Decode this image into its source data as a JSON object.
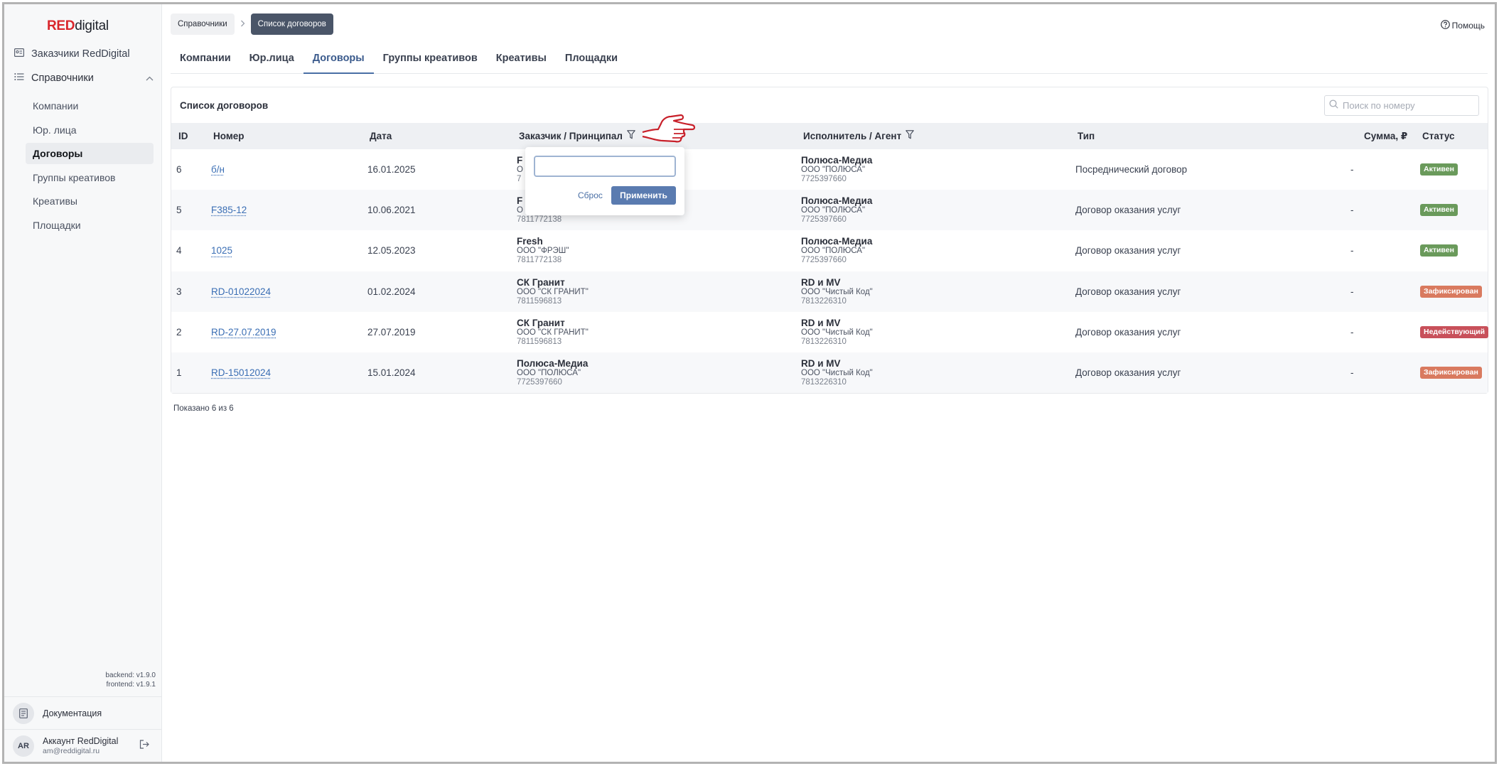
{
  "sidebar": {
    "logo_red": "RED",
    "logo_rest": "digital",
    "top_item": "Заказчики RedDigital",
    "section": "Справочники",
    "items": [
      {
        "label": "Компании",
        "active": false
      },
      {
        "label": "Юр. лица",
        "active": false
      },
      {
        "label": "Договоры",
        "active": true
      },
      {
        "label": "Группы креативов",
        "active": false
      },
      {
        "label": "Креативы",
        "active": false
      },
      {
        "label": "Площадки",
        "active": false
      }
    ],
    "backend_version": "backend: v1.9.0",
    "frontend_version": "frontend: v1.9.1",
    "docs": "Документация",
    "account_initials": "AR",
    "account_name": "Аккаунт RedDigital",
    "account_email": "am@reddigital.ru"
  },
  "breadcrumb": {
    "root": "Справочники",
    "current": "Список договоров"
  },
  "help": "Помощь",
  "tabs": [
    {
      "label": "Компании",
      "active": false
    },
    {
      "label": "Юр.лица",
      "active": false
    },
    {
      "label": "Договоры",
      "active": true
    },
    {
      "label": "Группы креативов",
      "active": false
    },
    {
      "label": "Креативы",
      "active": false
    },
    {
      "label": "Площадки",
      "active": false
    }
  ],
  "card": {
    "title": "Список договоров",
    "search_placeholder": "Поиск по номеру"
  },
  "table": {
    "headers": {
      "id": "ID",
      "number": "Номер",
      "date": "Дата",
      "client": "Заказчик / Принципал",
      "contractor": "Исполнитель / Агент",
      "type": "Тип",
      "sum": "Сумма, ₽",
      "status": "Статус"
    },
    "rows": [
      {
        "id": "6",
        "number": "б/н",
        "date": "16.01.2025",
        "client": {
          "name": "F",
          "legal": "О",
          "inn": "7"
        },
        "contractor": {
          "name": "Полюса-Медиа",
          "legal": "ООО \"ПОЛЮСА\"",
          "inn": "7725397660"
        },
        "type": "Посреднический договор",
        "sum": "-",
        "status": "Активен",
        "status_color": "#6a9a5b"
      },
      {
        "id": "5",
        "number": "F385-12",
        "date": "10.06.2021",
        "client": {
          "name": "F",
          "legal": "О",
          "inn": "7811772138"
        },
        "contractor": {
          "name": "Полюса-Медиа",
          "legal": "ООО \"ПОЛЮСА\"",
          "inn": "7725397660"
        },
        "type": "Договор оказания услуг",
        "sum": "-",
        "status": "Активен",
        "status_color": "#6a9a5b"
      },
      {
        "id": "4",
        "number": "1025",
        "date": "12.05.2023",
        "client": {
          "name": "Fresh",
          "legal": "ООО \"ФРЭШ\"",
          "inn": "7811772138"
        },
        "contractor": {
          "name": "Полюса-Медиа",
          "legal": "ООО \"ПОЛЮСА\"",
          "inn": "7725397660"
        },
        "type": "Договор оказания услуг",
        "sum": "-",
        "status": "Активен",
        "status_color": "#6a9a5b"
      },
      {
        "id": "3",
        "number": "RD-01022024",
        "date": "01.02.2024",
        "client": {
          "name": "СК Гранит",
          "legal": "ООО \"СК ГРАНИТ\"",
          "inn": "7811596813"
        },
        "contractor": {
          "name": "RD и MV",
          "legal": "ООО \"Чистый Код\"",
          "inn": "7813226310"
        },
        "type": "Договор оказания услуг",
        "sum": "-",
        "status": "Зафиксирован",
        "status_color": "#d97a5f"
      },
      {
        "id": "2",
        "number": "RD-27.07.2019",
        "date": "27.07.2019",
        "client": {
          "name": "СК Гранит",
          "legal": "ООО \"СК ГРАНИТ\"",
          "inn": "7811596813"
        },
        "contractor": {
          "name": "RD и MV",
          "legal": "ООО \"Чистый Код\"",
          "inn": "7813226310"
        },
        "type": "Договор оказания услуг",
        "sum": "-",
        "status": "Недействующий",
        "status_color": "#c8505a"
      },
      {
        "id": "1",
        "number": "RD-15012024",
        "date": "15.01.2024",
        "client": {
          "name": "Полюса-Медиа",
          "legal": "ООО \"ПОЛЮСА\"",
          "inn": "7725397660"
        },
        "contractor": {
          "name": "RD и MV",
          "legal": "ООО \"Чистый Код\"",
          "inn": "7813226310"
        },
        "type": "Договор оказания услуг",
        "sum": "-",
        "status": "Зафиксирован",
        "status_color": "#d97a5f"
      }
    ]
  },
  "footer": "Показано 6 из 6",
  "filter_popup": {
    "input_value": "",
    "reset": "Сброс",
    "apply": "Применить"
  },
  "colors": {
    "brand_red": "#d9262c",
    "accent": "#4a6fa5",
    "link": "#3a6eb4",
    "cursor_hand": "#c8202a"
  }
}
